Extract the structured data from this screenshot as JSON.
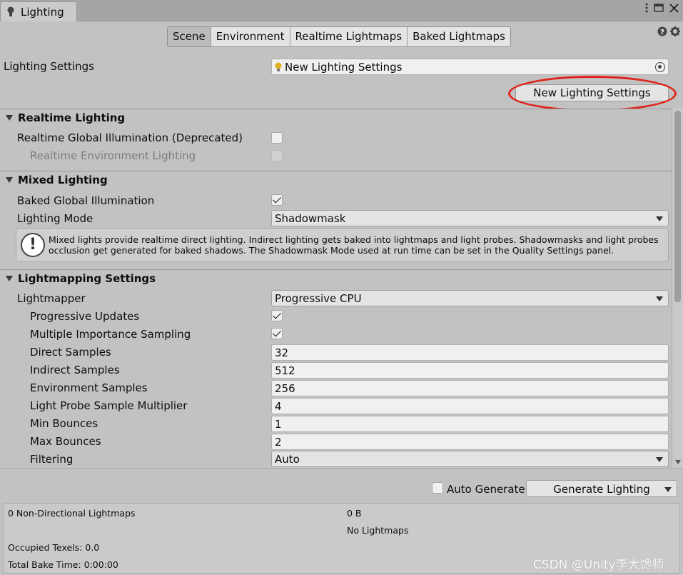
{
  "window": {
    "tab_title": "Lighting",
    "icons": [
      "kebab-menu-icon",
      "maximize-icon",
      "close-icon"
    ]
  },
  "tabs": [
    {
      "label": "Scene",
      "active": true
    },
    {
      "label": "Environment",
      "active": false
    },
    {
      "label": "Realtime Lightmaps",
      "active": false
    },
    {
      "label": "Baked Lightmaps",
      "active": false
    }
  ],
  "lighting_settings": {
    "label": "Lighting Settings",
    "value": "New Lighting Settings",
    "new_button": "New Lighting Settings"
  },
  "realtime": {
    "title": "Realtime Lighting",
    "gi_label": "Realtime Global Illumination (Deprecated)",
    "gi_checked": false,
    "env_label": "Realtime Environment Lighting",
    "env_checked": false
  },
  "mixed": {
    "title": "Mixed Lighting",
    "baked_gi_label": "Baked Global Illumination",
    "baked_gi_checked": true,
    "mode_label": "Lighting Mode",
    "mode_value": "Shadowmask",
    "help_line1": "Mixed lights provide realtime direct lighting. Indirect lighting gets baked into lightmaps and light probes. Shadowmasks and light probes",
    "help_line2": "occlusion get generated for baked shadows. The Shadowmask Mode used at run time can be set in the Quality Settings panel."
  },
  "lightmapping": {
    "title": "Lightmapping Settings",
    "lightmapper_label": "Lightmapper",
    "lightmapper_value": "Progressive CPU",
    "progressive_updates_label": "Progressive Updates",
    "progressive_updates_checked": true,
    "mis_label": "Multiple Importance Sampling",
    "mis_checked": true,
    "direct_samples_label": "Direct Samples",
    "direct_samples": "32",
    "indirect_samples_label": "Indirect Samples",
    "indirect_samples": "512",
    "environment_samples_label": "Environment Samples",
    "environment_samples": "256",
    "probe_mult_label": "Light Probe Sample Multiplier",
    "probe_mult": "4",
    "min_bounces_label": "Min Bounces",
    "min_bounces": "1",
    "max_bounces_label": "Max Bounces",
    "max_bounces": "2",
    "filtering_label": "Filtering",
    "filtering_value": "Auto"
  },
  "footer": {
    "auto_generate_label": "Auto Generate",
    "auto_generate_checked": false,
    "generate_button": "Generate Lighting"
  },
  "stats": {
    "lightmaps": "0 Non-Directional Lightmaps",
    "size": "0 B",
    "no_lightmaps": "No Lightmaps",
    "texels": "Occupied Texels: 0.0",
    "bake_time": "Total Bake Time: 0:00:00"
  },
  "watermark": "CSDN @Unity李大馋师",
  "colors": {
    "highlight_ellipse": "#e0231b",
    "panel_bg": "#c2c2c2"
  }
}
